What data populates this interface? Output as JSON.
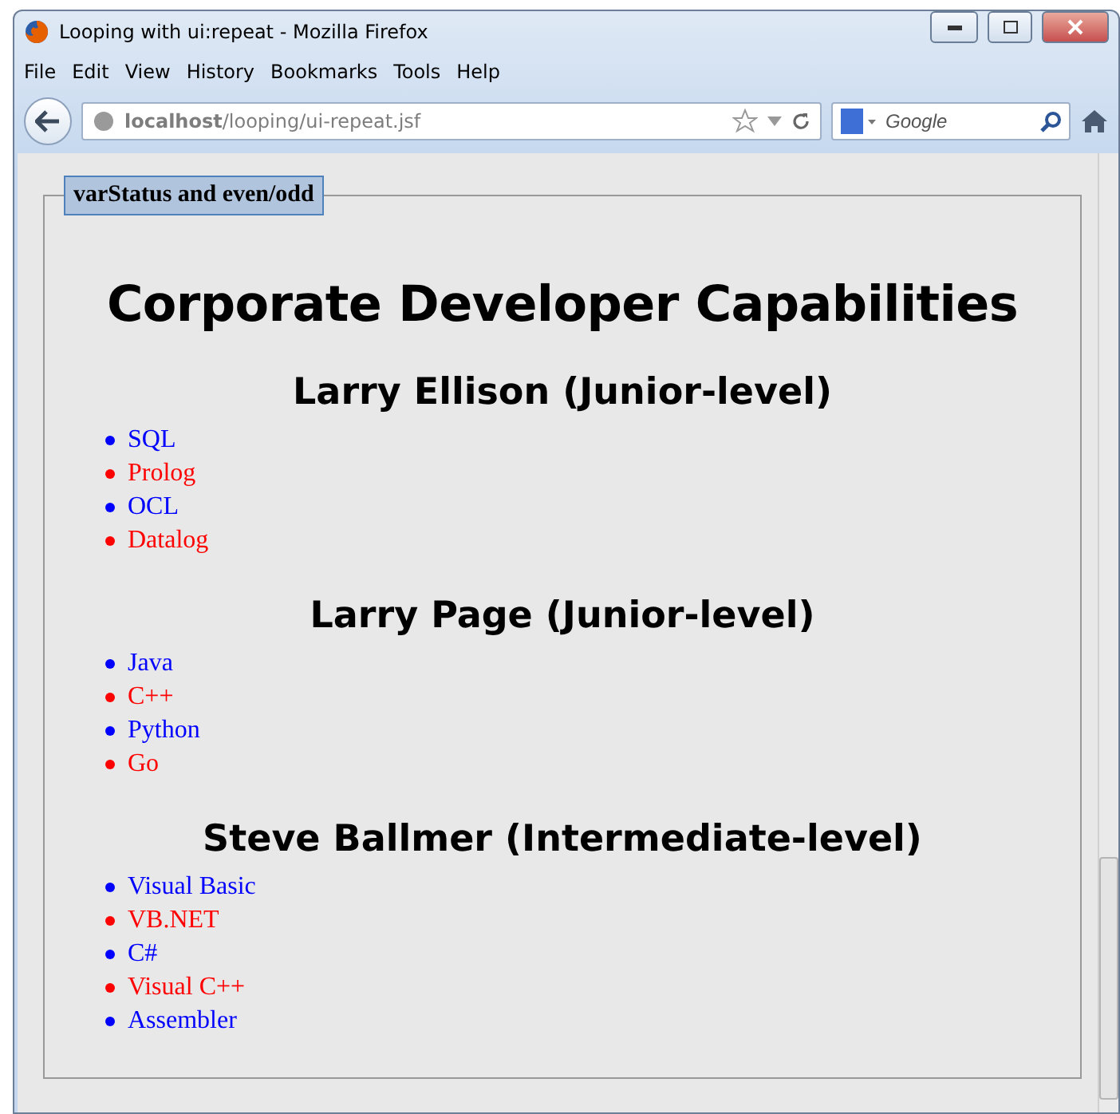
{
  "window": {
    "title": "Looping with ui:repeat - Mozilla Firefox"
  },
  "menu": [
    "File",
    "Edit",
    "View",
    "History",
    "Bookmarks",
    "Tools",
    "Help"
  ],
  "address_bar": {
    "url": "**localhost**/looping/ui-repeat.jsf"
  },
  "search": {
    "placeholder": "Google"
  },
  "fieldset": {
    "legend": "varStatus and even/odd"
  },
  "heading": "Corporate Developer Capabilities",
  "developers": [
    {
      "name": "Larry Ellison (Junior-level)",
      "languages": [
        {
          "label": "SQL",
          "color": "#0000ff"
        },
        {
          "label": "Prolog",
          "color": "#ff0000"
        },
        {
          "label": "OCL",
          "color": "#0000ff"
        },
        {
          "label": "Datalog",
          "color": "#ff0000"
        }
      ]
    },
    {
      "name": "Larry Page (Junior-level)",
      "languages": [
        {
          "label": "Java",
          "color": "#0000ff"
        },
        {
          "label": "C++",
          "color": "#ff0000"
        },
        {
          "label": "Python",
          "color": "#0000ff"
        },
        {
          "label": "Go",
          "color": "#ff0000"
        }
      ]
    },
    {
      "name": "Steve Ballmer (Intermediate-level)",
      "languages": [
        {
          "label": "Visual Basic",
          "color": "#0000ff"
        },
        {
          "label": "VB.NET",
          "color": "#ff0000"
        },
        {
          "label": "C#",
          "color": "#0000ff"
        },
        {
          "label": "Visual C++",
          "color": "#ff0000"
        },
        {
          "label": "Assembler",
          "color": "#0000ff"
        }
      ]
    }
  ]
}
